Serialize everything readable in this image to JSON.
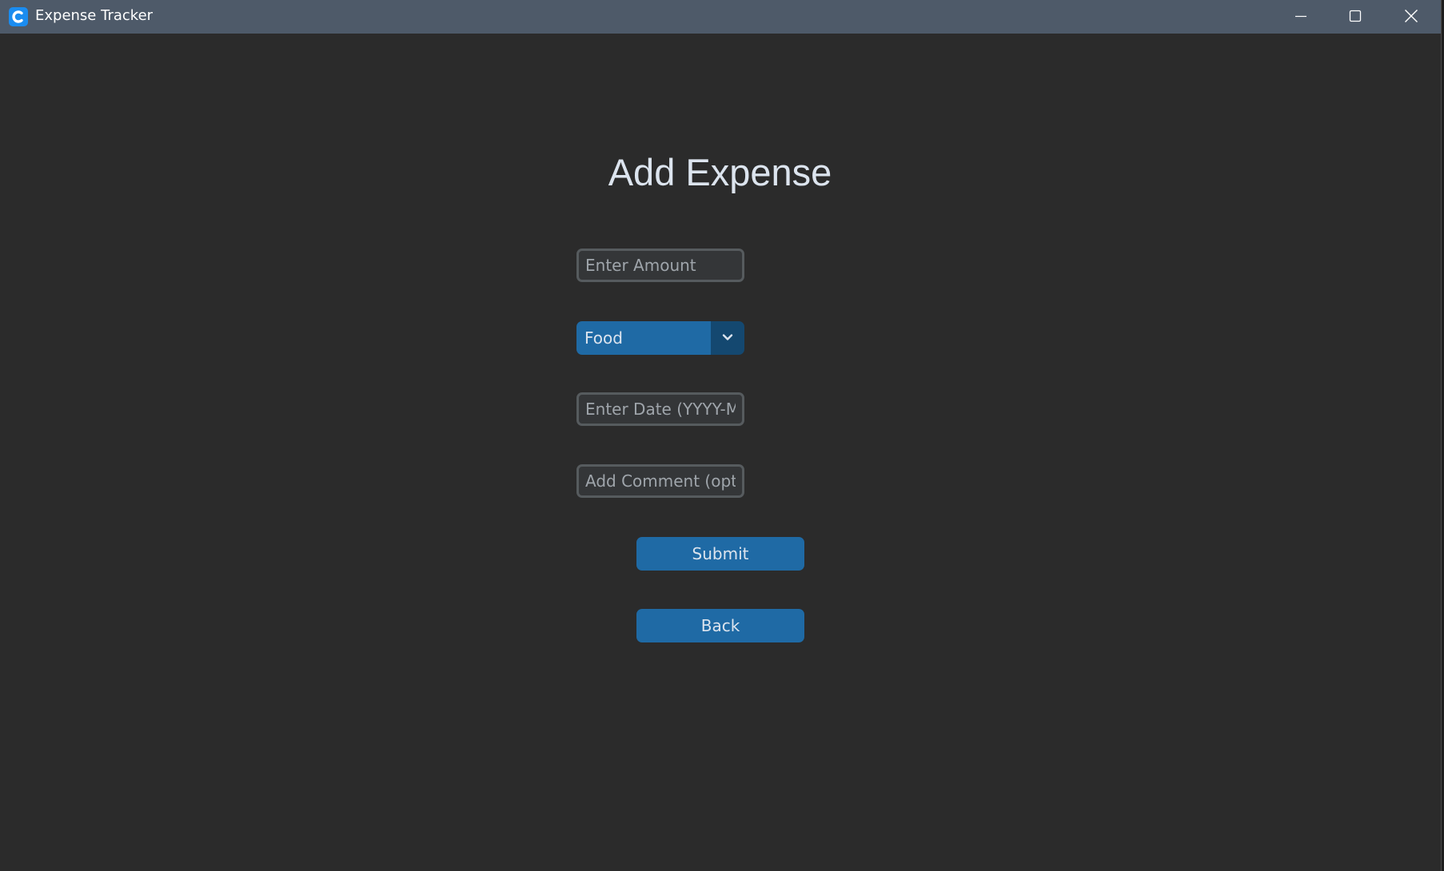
{
  "window": {
    "title": "Expense Tracker",
    "icon": "app-logo-icon",
    "controls": {
      "minimize": "minimize-icon",
      "maximize": "maximize-icon",
      "close": "close-icon"
    }
  },
  "form": {
    "heading": "Add Expense",
    "amount": {
      "value": "",
      "placeholder": "Enter Amount"
    },
    "category": {
      "selected": "Food",
      "icon": "chevron-down-icon"
    },
    "date": {
      "value": "",
      "placeholder": "Enter Date (YYYY-MM-DD)"
    },
    "comment": {
      "value": "",
      "placeholder": "Add Comment (optional)"
    },
    "submit_label": "Submit",
    "back_label": "Back"
  },
  "colors": {
    "background": "#2b2b2b",
    "titlebar": "#4e5a69",
    "accent": "#1f6aa5",
    "accent_dark": "#144870",
    "field_border": "#565b5e",
    "text": "#dce4ee",
    "placeholder": "#9fa5ab"
  }
}
